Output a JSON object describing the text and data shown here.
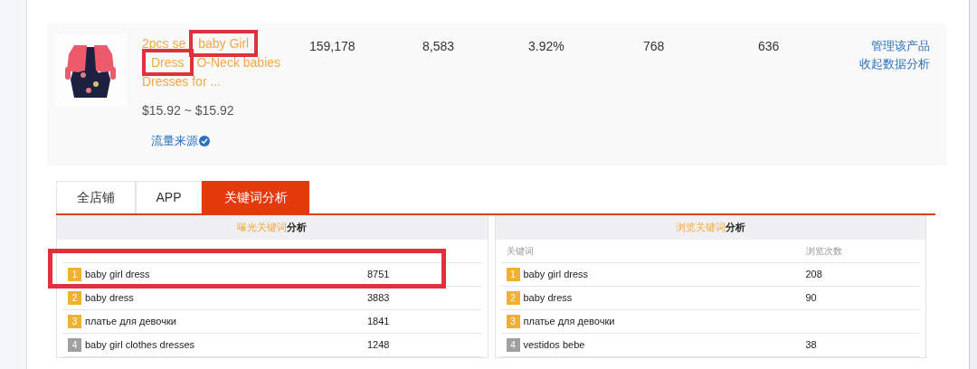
{
  "product": {
    "title_lines": [
      [
        {
          "text": "2pcs se",
          "highlighted": false
        },
        {
          "text": "baby Girl",
          "highlighted": true
        }
      ],
      [
        {
          "text": "Dress",
          "highlighted": true
        },
        {
          "text": "O-Neck babies",
          "highlighted": false
        }
      ],
      [
        {
          "text": "Dresses for ...",
          "highlighted": false
        }
      ]
    ],
    "price": "$15.92 ~ $15.92",
    "traffic_link": "流量来源",
    "stats": [
      "159,178",
      "8,583",
      "3.92%",
      "768",
      "636"
    ],
    "actions": [
      "管理该产品",
      "收起数据分析"
    ]
  },
  "tabs": [
    {
      "label": "全店铺",
      "selected": false
    },
    {
      "label": "APP",
      "selected": false
    },
    {
      "label": "关键词分析",
      "selected": true
    }
  ],
  "panels": [
    {
      "title_highlight": "曝光关键词",
      "title_rest": "分析",
      "rows": [
        {
          "rank": "1",
          "color": "#f0b030",
          "keyword": "baby girl dress",
          "value": "8751",
          "highlighted": true
        },
        {
          "rank": "2",
          "color": "#f0b030",
          "keyword": "baby dress",
          "value": "3883",
          "highlighted": false
        },
        {
          "rank": "3",
          "color": "#f0b030",
          "keyword": "платье для девочки",
          "value": "1841",
          "highlighted": false
        },
        {
          "rank": "4",
          "color": "#a0a0a0",
          "keyword": "baby girl clothes dresses",
          "value": "1248",
          "highlighted": false
        }
      ]
    },
    {
      "title_highlight": "浏览关键词",
      "title_rest": "分析",
      "columns": [
        "关键词",
        "浏览次数"
      ],
      "rows": [
        {
          "rank": "1",
          "color": "#f0b030",
          "keyword": "baby girl dress",
          "value": "208",
          "highlighted": false
        },
        {
          "rank": "2",
          "color": "#f0b030",
          "keyword": "baby dress",
          "value": "90",
          "highlighted": false
        },
        {
          "rank": "3",
          "color": "#f0b030",
          "keyword": "платье для девочки",
          "highlighted": false
        },
        {
          "rank": "4",
          "color": "#a0a0a0",
          "keyword": "vestidos bebe",
          "value": "38",
          "highlighted": false
        }
      ]
    }
  ]
}
